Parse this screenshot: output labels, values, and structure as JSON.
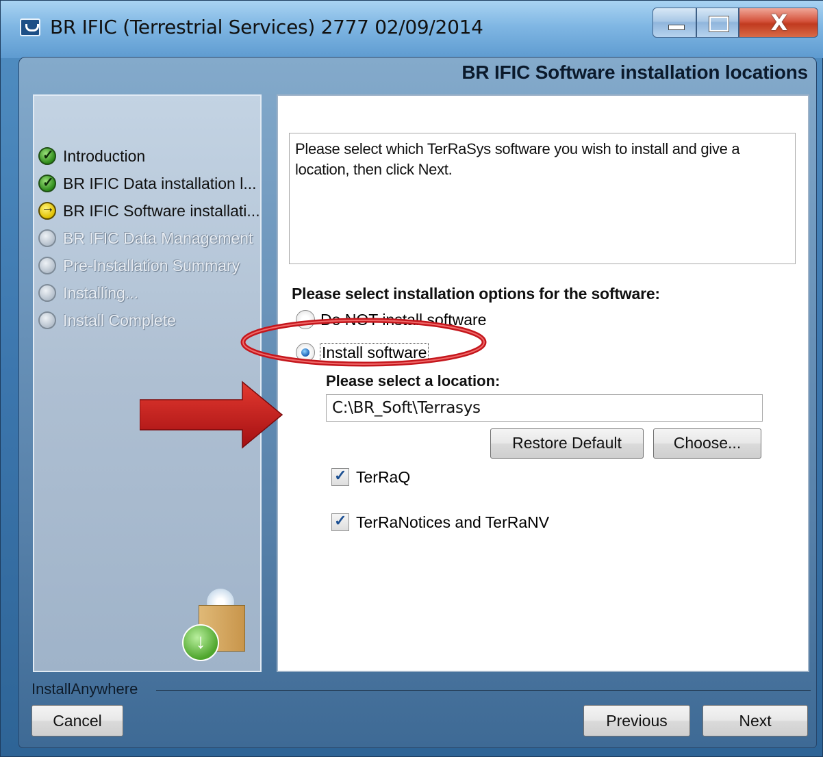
{
  "window": {
    "title": "BR IFIC (Terrestrial Services) 2777 02/09/2014",
    "close_glyph": "X"
  },
  "header": {
    "title": "BR IFIC Software installation locations"
  },
  "steps": [
    {
      "label": "Introduction",
      "state": "done"
    },
    {
      "label": "BR IFIC Data installation l...",
      "state": "done"
    },
    {
      "label": "BR IFIC Software installati...",
      "state": "current"
    },
    {
      "label": "BR IFIC Data Management",
      "state": "pending"
    },
    {
      "label": "Pre-Installation Summary",
      "state": "pending"
    },
    {
      "label": "Installing...",
      "state": "pending"
    },
    {
      "label": "Install Complete",
      "state": "pending"
    }
  ],
  "content": {
    "description": "Please select which TerRaSys software you wish to install and give a location, then click Next.",
    "options_label": "Please select installation options for the software:",
    "radio_options": [
      {
        "label": "Do NOT install software",
        "selected": false
      },
      {
        "label": "Install software",
        "selected": true
      }
    ],
    "location_label": "Please select a location:",
    "location_value": "C:\\BR_Soft\\Terrasys",
    "restore_default_label": "Restore Default",
    "choose_label": "Choose...",
    "components": [
      {
        "label": "TerRaQ",
        "checked": true
      },
      {
        "label": "TerRaNotices and TerRaNV",
        "checked": true
      }
    ]
  },
  "footer": {
    "brand": "InstallAnywhere",
    "cancel_label": "Cancel",
    "previous_label": "Previous",
    "next_label": "Next"
  },
  "colors": {
    "annotation_red": "#c4161c",
    "dialog_blue": "#557fa8"
  }
}
